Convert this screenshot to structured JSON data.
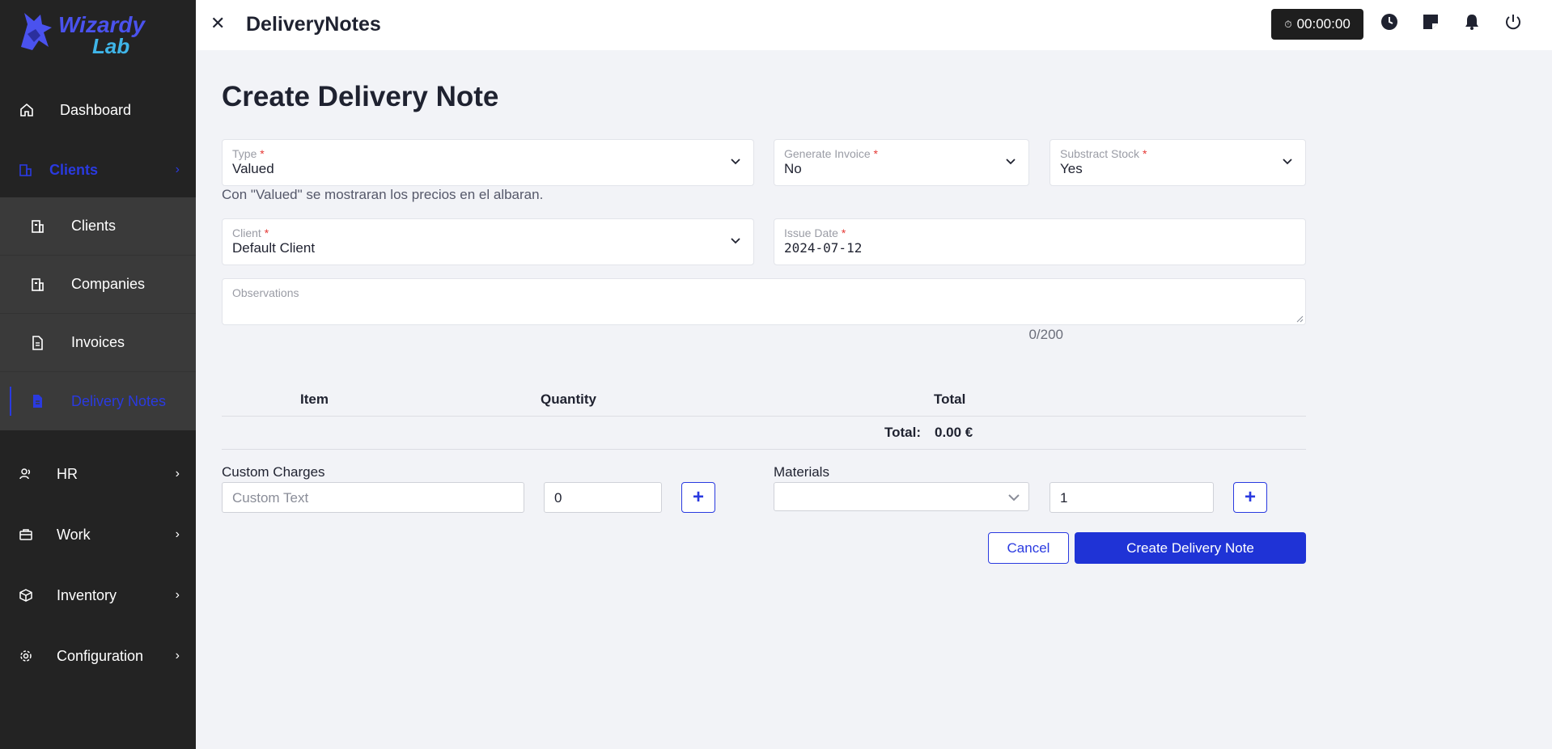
{
  "brand": {
    "logo_name": "Wizardy",
    "logo_sub": "Lab"
  },
  "sidebar": {
    "items": [
      {
        "label": "Dashboard",
        "icon": "home-icon"
      },
      {
        "label": "Clients",
        "icon": "building-icon",
        "active": true
      },
      {
        "label": "HR",
        "icon": "users-icon"
      },
      {
        "label": "Work",
        "icon": "briefcase-icon"
      },
      {
        "label": "Inventory",
        "icon": "box-icon"
      },
      {
        "label": "Configuration",
        "icon": "gear-icon"
      }
    ],
    "subitems": [
      {
        "label": "Clients",
        "icon": "building-icon"
      },
      {
        "label": "Companies",
        "icon": "building-icon"
      },
      {
        "label": "Invoices",
        "icon": "document-icon"
      },
      {
        "label": "Delivery Notes",
        "icon": "document-icon",
        "active": true
      }
    ],
    "accent": "#2a3ae0"
  },
  "topbar": {
    "title": "DeliveryNotes",
    "timer": "00:00:00"
  },
  "page": {
    "title": "Create Delivery Note",
    "type": {
      "label": "Type",
      "value": "Valued"
    },
    "generate_invoice": {
      "label": "Generate Invoice",
      "value": "No"
    },
    "substract_stock": {
      "label": "Substract Stock",
      "value": "Yes"
    },
    "hint": "Con \"Valued\" se mostraran los precios en el albaran.",
    "client": {
      "label": "Client",
      "value": "Default Client"
    },
    "issue_date": {
      "label": "Issue Date",
      "value": "2024-07-12"
    },
    "observations": {
      "label": "Observations",
      "value": ""
    },
    "counter": "0/200",
    "req_mark": "*"
  },
  "table": {
    "headers": [
      "Item",
      "Quantity",
      "Total"
    ],
    "total_label": "Total:",
    "total_value": "0.00 €"
  },
  "custom_charges": {
    "label": "Custom Charges",
    "text_placeholder": "Custom Text",
    "amount": "0",
    "add": "+"
  },
  "materials": {
    "label": "Materials",
    "selected": "",
    "quantity": "1",
    "add": "+"
  },
  "actions": {
    "cancel": "Cancel",
    "create": "Create Delivery Note"
  }
}
